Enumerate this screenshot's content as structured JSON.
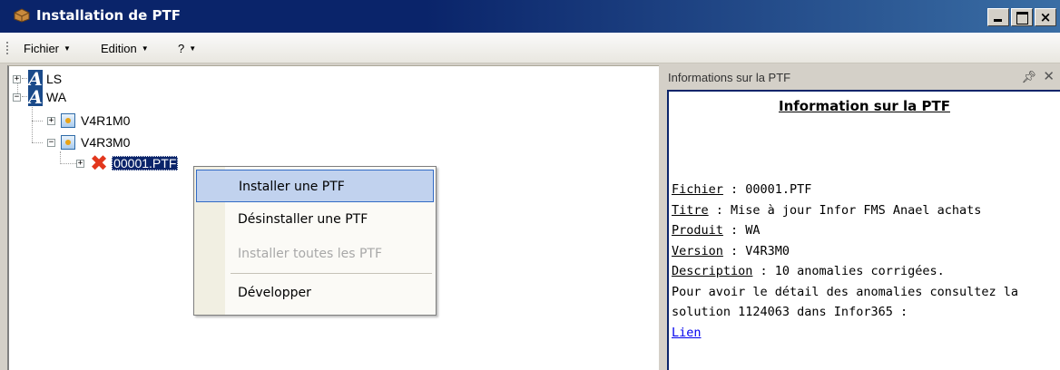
{
  "window": {
    "title": "Installation de PTF"
  },
  "menubar": {
    "items": [
      "Fichier",
      "Edition",
      "?"
    ]
  },
  "tree": {
    "nodes": [
      {
        "label": "LS",
        "icon": "infor-logo-icon"
      },
      {
        "label": "WA",
        "icon": "infor-logo-icon"
      },
      {
        "label": "V4R1M0",
        "icon": "package-icon"
      },
      {
        "label": "V4R3M0",
        "icon": "package-icon"
      },
      {
        "label": "00001.PTF",
        "icon": "error-x-icon"
      }
    ]
  },
  "context_menu": {
    "items": [
      {
        "label": "Installer une PTF",
        "state": "hover"
      },
      {
        "label": "Désinstaller une PTF",
        "state": "normal"
      },
      {
        "label": "Installer toutes les PTF",
        "state": "disabled"
      },
      {
        "label": "Développer",
        "state": "normal"
      }
    ]
  },
  "info_panel": {
    "header": "Informations sur la PTF",
    "heading": "Information sur la PTF",
    "fichier_label": "Fichier",
    "fichier_value": " : 00001.PTF",
    "titre_label": "Titre",
    "titre_value": " : Mise à jour Infor FMS Anael achats",
    "produit_label": "Produit",
    "produit_value": " : WA",
    "version_label": "Version",
    "version_value": " : V4R3M0",
    "description_label": "Description",
    "description_value": " : 10 anomalies corrigées.",
    "detail_line1": "Pour avoir le détail des anomalies consultez la",
    "detail_line2": "solution 1124063 dans Infor365 :",
    "link": "Lien"
  },
  "colors": {
    "titlebar": "#0a246a",
    "selection": "#0a246a",
    "menu_hover": "#c1d2ee",
    "error_icon": "#e2371d"
  }
}
